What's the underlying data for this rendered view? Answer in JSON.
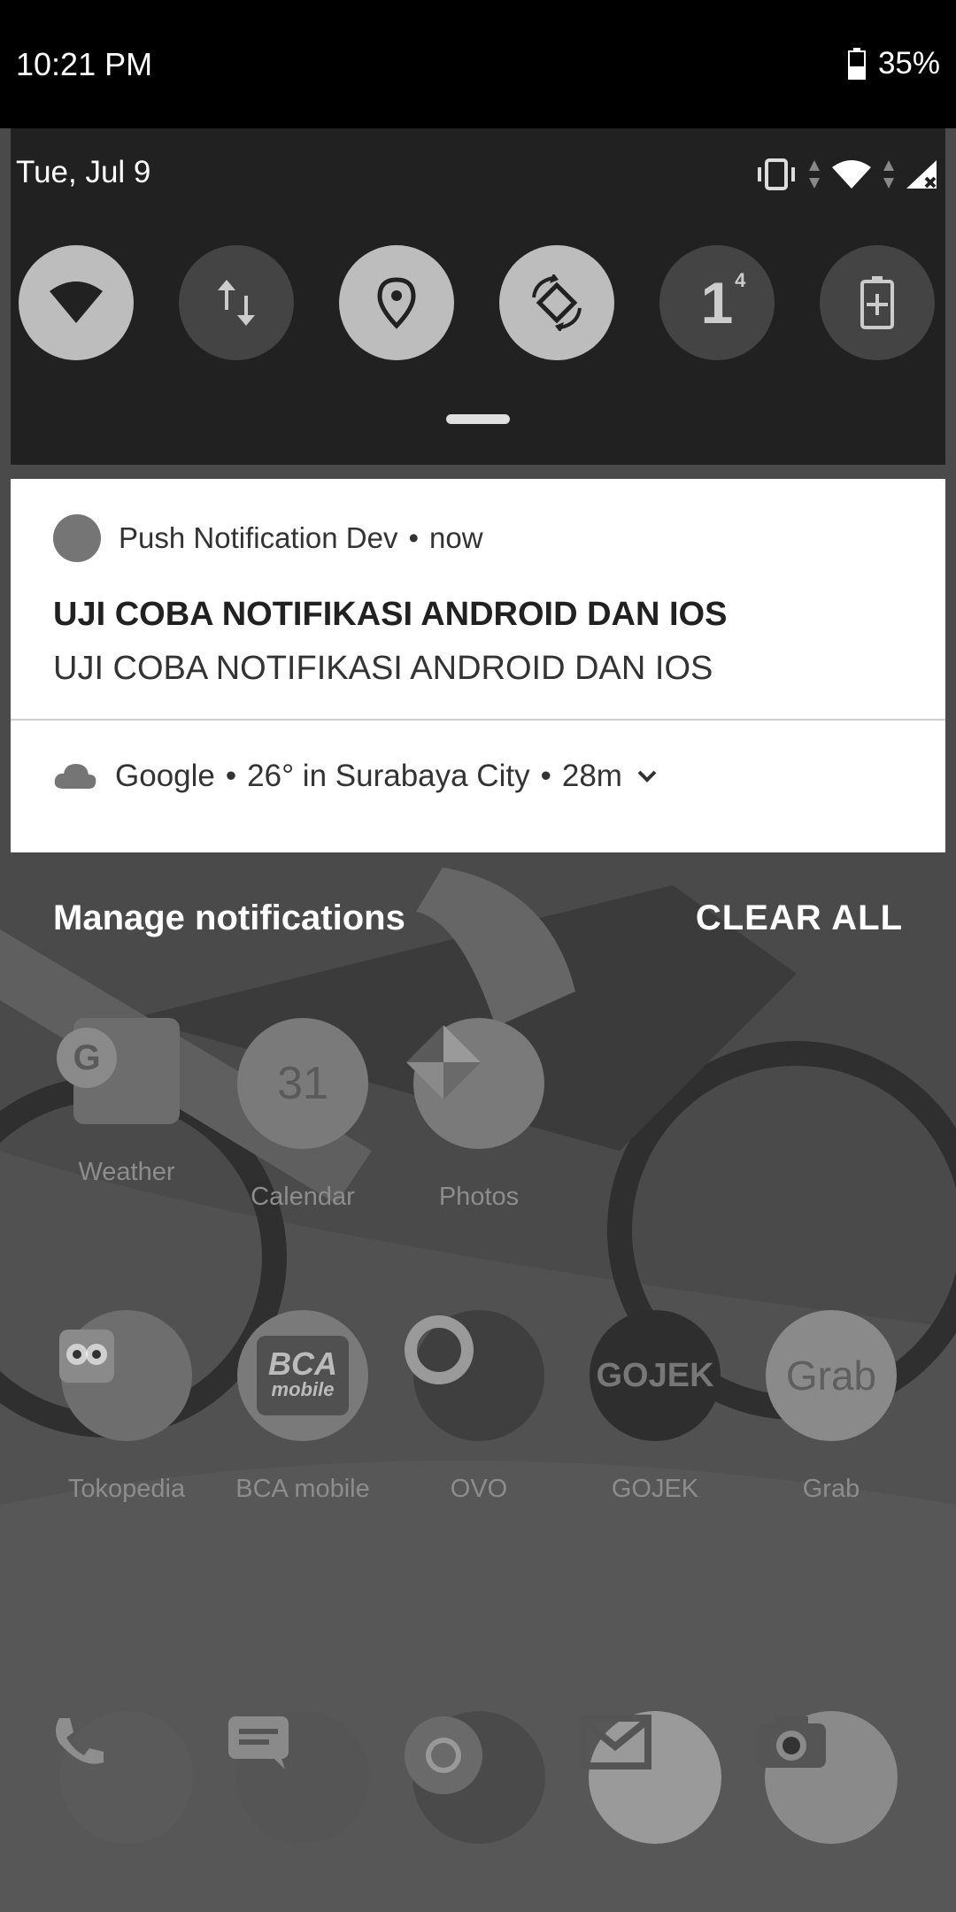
{
  "status_bar": {
    "time": "10:21 PM",
    "battery_percent": "35%"
  },
  "quick_settings": {
    "date": "Tue, Jul 9",
    "tiles": [
      {
        "name": "wifi",
        "icon": "wifi-icon",
        "on": true
      },
      {
        "name": "mobile data",
        "icon": "data-arrows-icon",
        "on": false
      },
      {
        "name": "location",
        "icon": "location-pin-icon",
        "on": true
      },
      {
        "name": "auto rotate",
        "icon": "rotate-icon",
        "on": true
      },
      {
        "name": "sim",
        "icon": "sim-1-icon",
        "on": false,
        "label": "1",
        "superscript": "4"
      },
      {
        "name": "battery saver",
        "icon": "battery-plus-icon",
        "on": false
      }
    ]
  },
  "notifications": [
    {
      "app": "Push Notification Dev",
      "time": "now",
      "title": "UJI COBA NOTIFIKASI ANDROID DAN IOS",
      "body": "UJI COBA NOTIFIKASI ANDROID DAN IOS"
    },
    {
      "app": "Google",
      "summary": "26° in Surabaya City",
      "time": "28m",
      "icon": "cloud-icon"
    }
  ],
  "footer": {
    "manage": "Manage notifications",
    "clear_all": "CLEAR ALL"
  },
  "home": {
    "row1": [
      {
        "label": "Weather"
      },
      {
        "label": "Calendar",
        "date": "31"
      },
      {
        "label": "Photos"
      }
    ],
    "row2": [
      {
        "label": "Tokopedia"
      },
      {
        "label": "BCA mobile",
        "logo_line1": "BCA",
        "logo_line2": "mobile"
      },
      {
        "label": "OVO"
      },
      {
        "label": "GOJEK",
        "logo": "GOJEK"
      },
      {
        "label": "Grab",
        "logo": "Grab"
      }
    ],
    "dock": [
      {
        "icon": "phone-icon"
      },
      {
        "icon": "messages-icon"
      },
      {
        "icon": "chrome-icon"
      },
      {
        "icon": "gmail-icon"
      },
      {
        "icon": "camera-icon"
      }
    ]
  },
  "colors": {
    "panel": "#212121",
    "card": "#ffffff",
    "tile_on": "#bdbdbd",
    "tile_off": "#444444"
  }
}
